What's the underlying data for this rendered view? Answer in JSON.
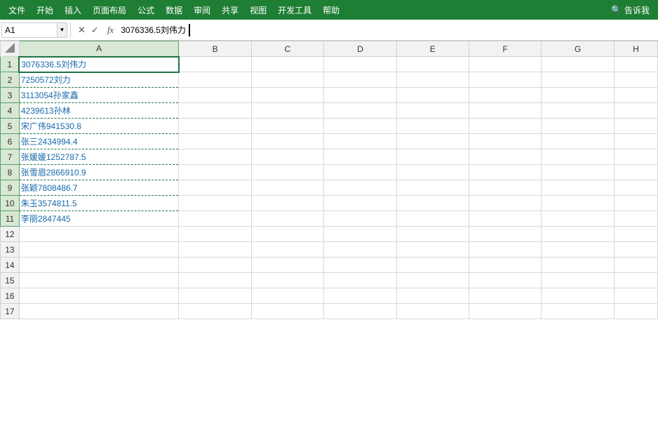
{
  "menubar": {
    "items": [
      {
        "label": "文件"
      },
      {
        "label": "开始"
      },
      {
        "label": "插入"
      },
      {
        "label": "页面布局"
      },
      {
        "label": "公式"
      },
      {
        "label": "数据"
      },
      {
        "label": "审阅"
      },
      {
        "label": "共享"
      },
      {
        "label": "视图"
      },
      {
        "label": "开发工具"
      },
      {
        "label": "帮助"
      }
    ],
    "search_icon": "🔍",
    "search_label": "告诉我"
  },
  "formula_bar": {
    "cell_ref": "A1",
    "formula_content": "3076336.5刘伟力",
    "cancel_icon": "✕",
    "confirm_icon": "✓",
    "fx_label": "fx"
  },
  "spreadsheet": {
    "col_headers": [
      "A",
      "B",
      "C",
      "D",
      "E",
      "F",
      "G",
      "H"
    ],
    "rows": [
      {
        "row_num": 1,
        "a": "3076336.5刘伟力",
        "active": true
      },
      {
        "row_num": 2,
        "a": "7250572刘力",
        "active": false
      },
      {
        "row_num": 3,
        "a": "3113054孙家鑫",
        "active": false
      },
      {
        "row_num": 4,
        "a": "4239613孙林",
        "active": false
      },
      {
        "row_num": 5,
        "a": "宋广伟941530.8",
        "active": false
      },
      {
        "row_num": 6,
        "a": "张三2434994.4",
        "active": false
      },
      {
        "row_num": 7,
        "a": "张媛媛1252787.5",
        "active": false
      },
      {
        "row_num": 8,
        "a": "张雪眉2866910.9",
        "active": false
      },
      {
        "row_num": 9,
        "a": "张颖7808486.7",
        "active": false
      },
      {
        "row_num": 10,
        "a": "朱玉3574811.5",
        "active": false
      },
      {
        "row_num": 11,
        "a": "李丽2847445",
        "active": false
      },
      {
        "row_num": 12,
        "a": "",
        "active": false
      },
      {
        "row_num": 13,
        "a": "",
        "active": false
      },
      {
        "row_num": 14,
        "a": "",
        "active": false
      },
      {
        "row_num": 15,
        "a": "",
        "active": false
      },
      {
        "row_num": 16,
        "a": "",
        "active": false
      },
      {
        "row_num": 17,
        "a": "",
        "active": false
      }
    ]
  }
}
